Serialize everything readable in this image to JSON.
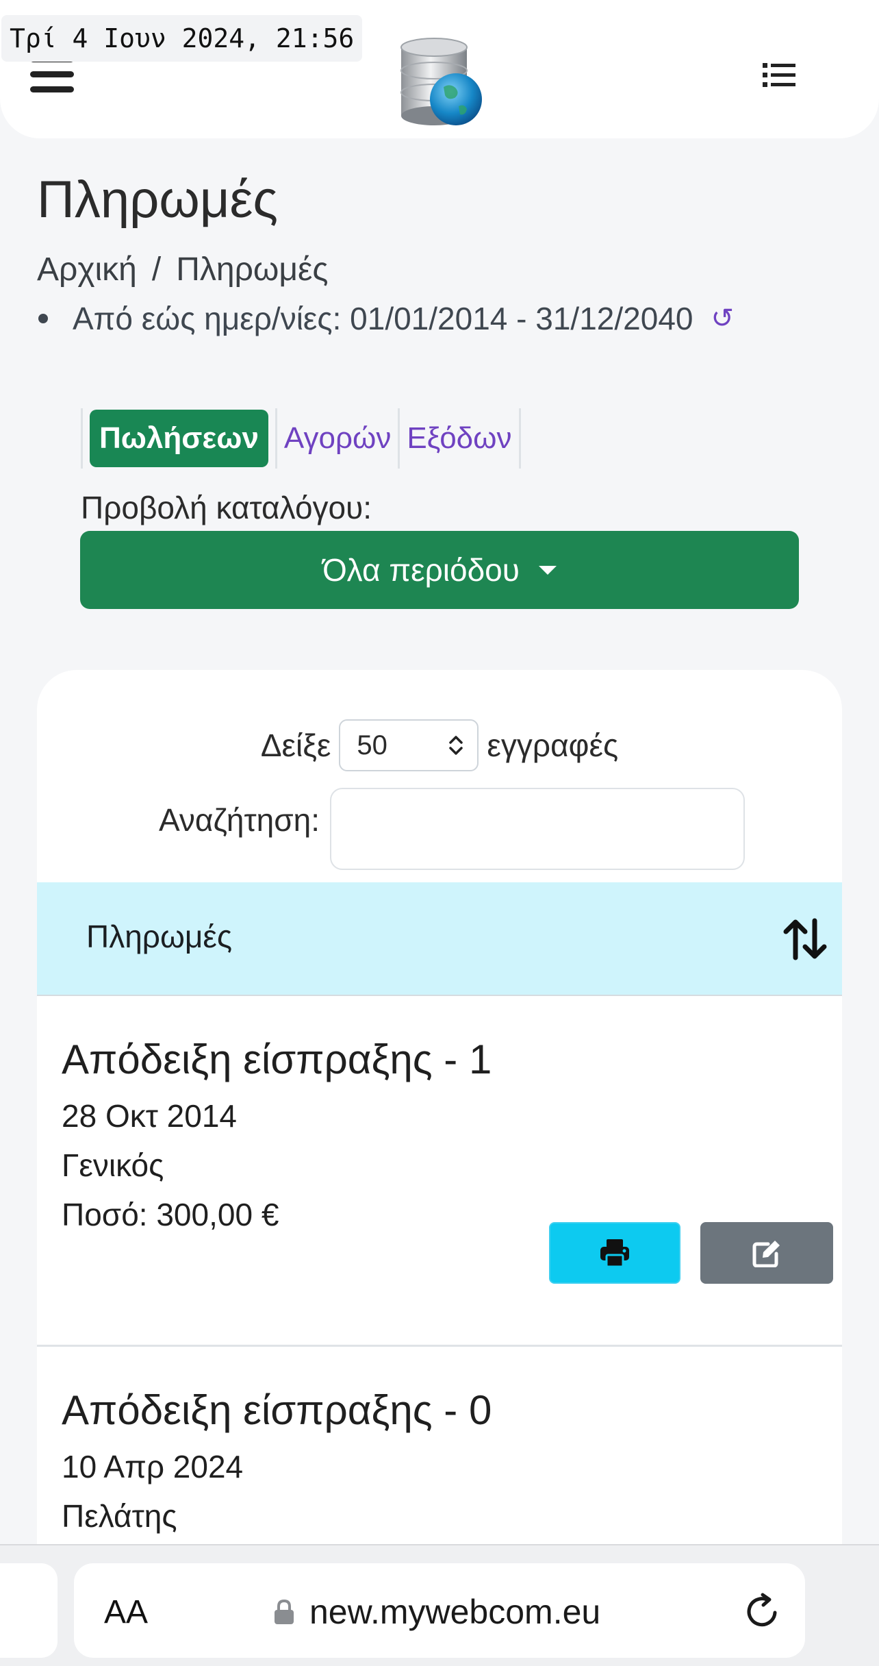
{
  "status": {
    "timestamp": "Τρί 4 Ιουν 2024, 21:56"
  },
  "header": {
    "menu_icon": "hamburger-menu-icon",
    "logo": "database-globe-logo",
    "list_icon": "list-icon"
  },
  "page": {
    "title": "Πληρωμές",
    "breadcrumb": {
      "home": "Αρχική",
      "separator": "/",
      "current": "Πληρωμές"
    },
    "date_range": "Από εώς ημερ/νίες: 01/01/2014 - 31/12/2040",
    "reset_icon": "↺"
  },
  "tabs": [
    {
      "label": "Πωλήσεων",
      "active": true
    },
    {
      "label": "Αγορών",
      "active": false
    },
    {
      "label": "Εξόδων",
      "active": false
    }
  ],
  "view": {
    "label": "Προβολή καταλόγου:",
    "selected": "Όλα περιόδου"
  },
  "table": {
    "length_prefix": "Δείξε",
    "length_value": "50",
    "length_suffix": "εγγραφές",
    "search_label": "Αναζήτηση:",
    "search_value": "",
    "column_header": "Πληρωμές",
    "rows": [
      {
        "title": "Απόδειξη είσπραξης - 1",
        "date": "28 Οκτ 2014",
        "party": "Γενικός",
        "amount": "Ποσό: 300,00 €"
      },
      {
        "title": "Απόδειξη είσπραξης - 0",
        "date": "10 Απρ 2024",
        "party": "Πελάτης"
      }
    ]
  },
  "browser": {
    "text_size": "AA",
    "url": "new.mywebcom.eu"
  },
  "colors": {
    "success": "#198754",
    "accent": "#6f42c1",
    "info": "#0dcaf0",
    "secondary": "#6c757d",
    "table_head": "#cff4fc"
  }
}
